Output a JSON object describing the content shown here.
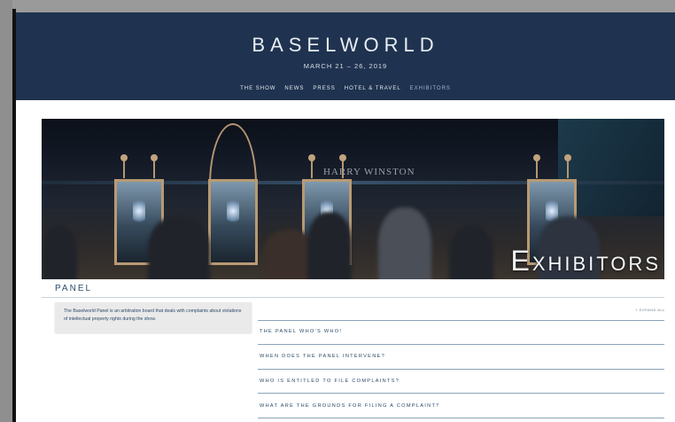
{
  "header": {
    "brand": "BASELWORLD",
    "dates": "MARCH 21 – 26, 2019",
    "nav": [
      "THE SHOW",
      "NEWS",
      "PRESS",
      "HOTEL & TRAVEL",
      "EXHIBITORS"
    ],
    "active_nav": "EXHIBITORS"
  },
  "hero": {
    "sign": "HARRY WINSTON",
    "title": "Exhibitors"
  },
  "section": {
    "title": "PANEL",
    "intro": "The Baselworld Panel is an arbitration board that deals with complaints about violations of intellectual property rights during the show.",
    "expand_all": "+ EXPAND ALL"
  },
  "faq": [
    "THE PANEL WHO'S WHO!",
    "WHEN DOES THE PANEL INTERVENE?",
    "WHO IS ENTITLED TO FILE COMPLAINTS?",
    "WHAT ARE THE GROUNDS FOR FILING A COMPLAINT?"
  ],
  "colors": {
    "header_bg": "#1f3350",
    "accent": "#2b4a68",
    "active_nav": "#9fb6cf"
  }
}
